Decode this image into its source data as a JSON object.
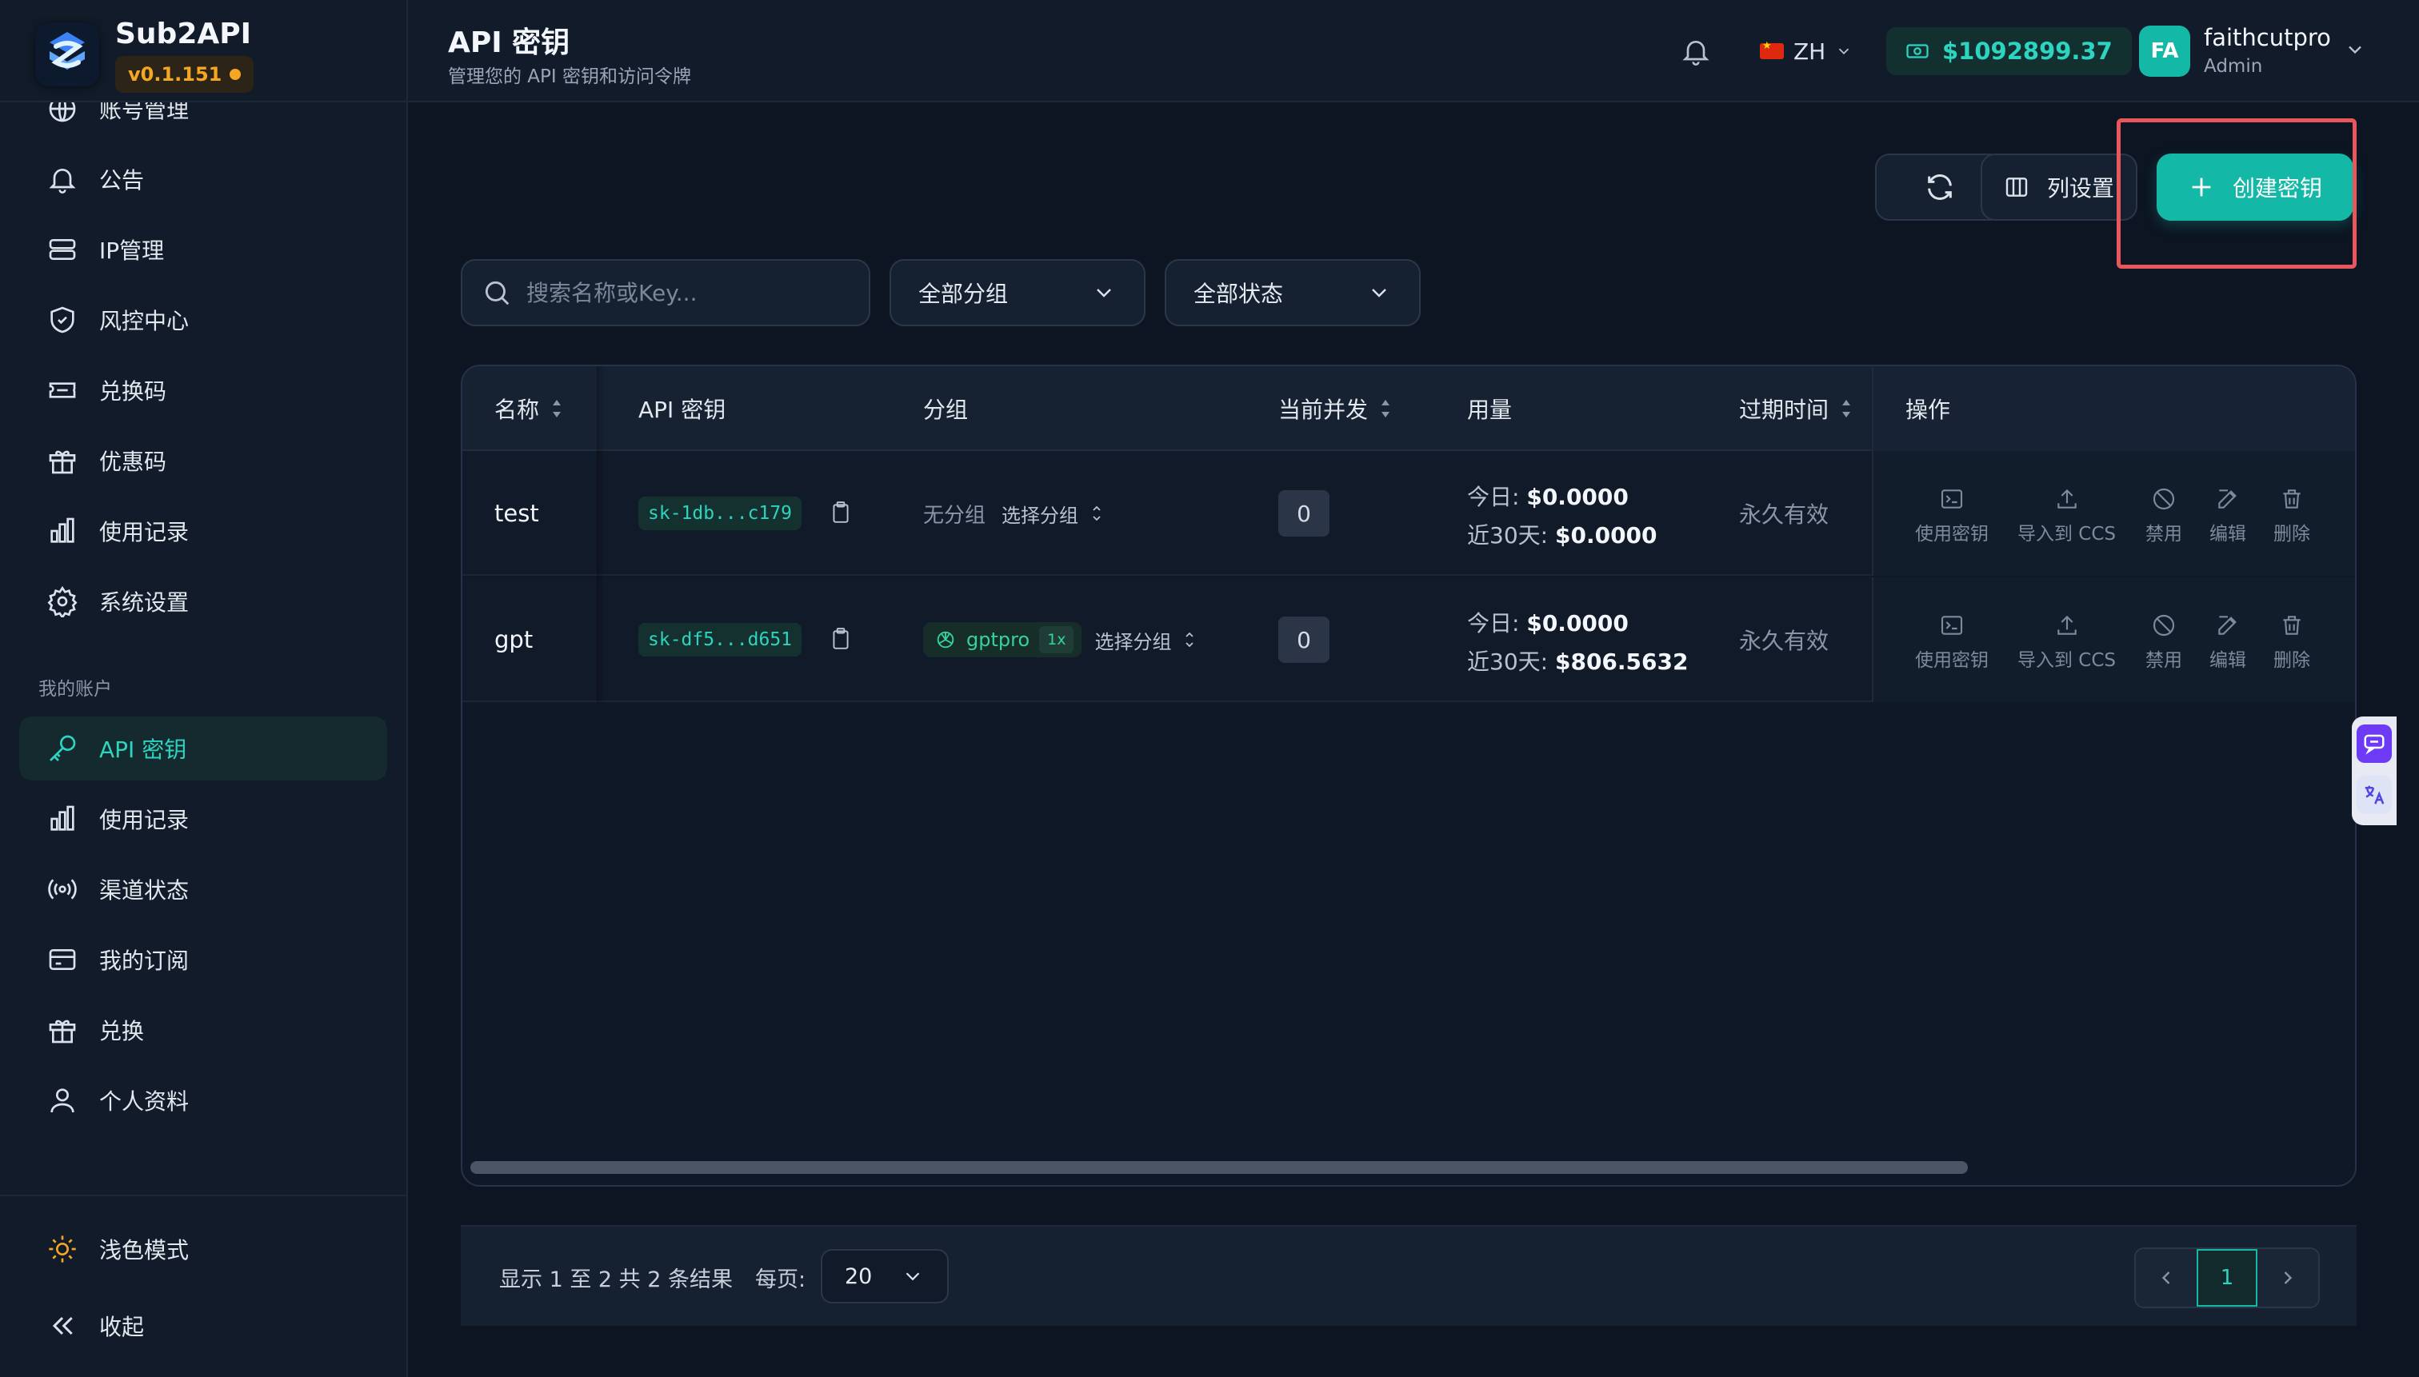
{
  "brand": {
    "name": "Sub2API",
    "version": "v0.1.151",
    "accent": "#14b8a6"
  },
  "sidebar": {
    "items": [
      {
        "label": "账号管理",
        "icon": "globe-icon"
      },
      {
        "label": "公告",
        "icon": "bell-icon"
      },
      {
        "label": "IP管理",
        "icon": "server-icon"
      },
      {
        "label": "风控中心",
        "icon": "shield-icon"
      },
      {
        "label": "兑换码",
        "icon": "ticket-icon"
      },
      {
        "label": "优惠码",
        "icon": "gift-icon"
      },
      {
        "label": "使用记录",
        "icon": "bar-chart-icon"
      },
      {
        "label": "系统设置",
        "icon": "gear-icon"
      }
    ],
    "section_title": "我的账户",
    "account_items": [
      {
        "label": "API 密钥",
        "icon": "key-icon",
        "active": true
      },
      {
        "label": "使用记录",
        "icon": "bar-chart-icon"
      },
      {
        "label": "渠道状态",
        "icon": "broadcast-icon"
      },
      {
        "label": "我的订阅",
        "icon": "credit-card-icon"
      },
      {
        "label": "兑换",
        "icon": "gift-icon"
      },
      {
        "label": "个人资料",
        "icon": "user-icon"
      }
    ],
    "theme_toggle": "浅色模式",
    "collapse": "收起"
  },
  "header": {
    "title": "API 密钥",
    "subtitle": "管理您的 API 密钥和访问令牌",
    "language": "ZH",
    "balance": "$1092899.37",
    "avatar_initials": "FA",
    "user_name": "faithcutpro",
    "user_role": "Admin"
  },
  "toolbar": {
    "columns_label": "列设置",
    "create_label": "创建密钥"
  },
  "filters": {
    "search_placeholder": "搜索名称或Key...",
    "group_filter": "全部分组",
    "status_filter": "全部状态"
  },
  "table": {
    "headers": {
      "name": "名称",
      "key": "API 密钥",
      "group": "分组",
      "concurrency": "当前并发",
      "usage": "用量",
      "expiry": "过期时间",
      "actions": "操作"
    },
    "action_labels": {
      "use": "使用密钥",
      "import": "导入到 CCS",
      "disable": "禁用",
      "edit": "编辑",
      "delete": "删除"
    },
    "rows": [
      {
        "name": "test",
        "key": "sk-1db...c179",
        "group": "无分组",
        "group_select": "选择分组",
        "concurrency": "0",
        "today_label": "今日:",
        "today": "$0.0000",
        "month_label": "近30天:",
        "month": "$0.0000",
        "expiry": "永久有效"
      },
      {
        "name": "gpt",
        "key": "sk-df5...d651",
        "group": "gptpro",
        "group_rate": "1x",
        "group_select": "选择分组",
        "concurrency": "0",
        "today_label": "今日:",
        "today": "$0.0000",
        "month_label": "近30天:",
        "month": "$806.5632",
        "expiry": "永久有效"
      }
    ]
  },
  "pagination": {
    "summary": "显示 1 至 2 共 2 条结果",
    "per_page_label": "每页:",
    "per_page": "20",
    "current_page": "1"
  }
}
